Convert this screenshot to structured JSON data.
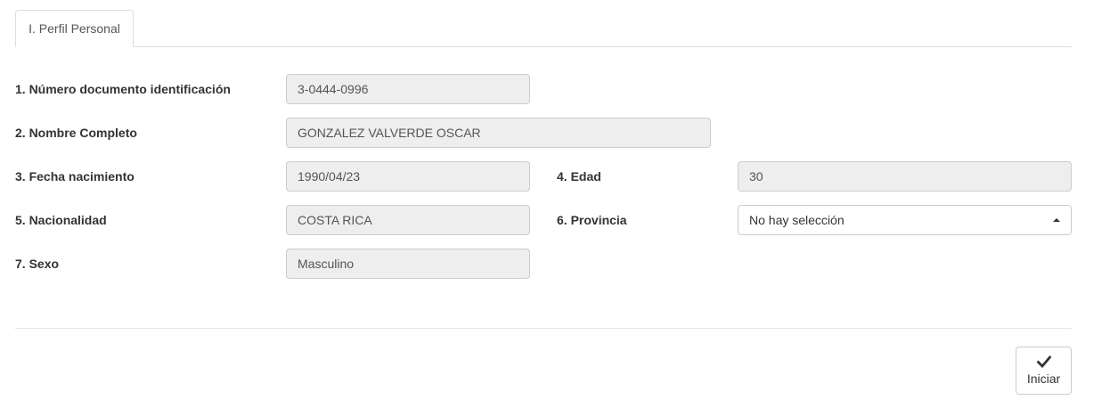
{
  "tabs": [
    {
      "label": "I. Perfil Personal",
      "active": true
    }
  ],
  "form": {
    "documento": {
      "label": "1. Número documento identificación",
      "value": "3-0444-0996"
    },
    "nombre": {
      "label": "2. Nombre Completo",
      "value": "GONZALEZ VALVERDE OSCAR"
    },
    "fecha_nacimiento": {
      "label": "3. Fecha nacimiento",
      "value": "1990/04/23"
    },
    "edad": {
      "label": "4. Edad",
      "value": "30"
    },
    "nacionalidad": {
      "label": "5. Nacionalidad",
      "value": "COSTA RICA"
    },
    "provincia": {
      "label": "6. Provincia",
      "value": "No hay selección"
    },
    "sexo": {
      "label": "7. Sexo",
      "value": "Masculino"
    }
  },
  "actions": {
    "iniciar": {
      "label": "Iniciar",
      "icon": "checkmark-icon"
    }
  },
  "colors": {
    "readonly_bg": "#eeeeee",
    "border": "#cccccc",
    "text": "#333333",
    "muted_text": "#555555"
  }
}
